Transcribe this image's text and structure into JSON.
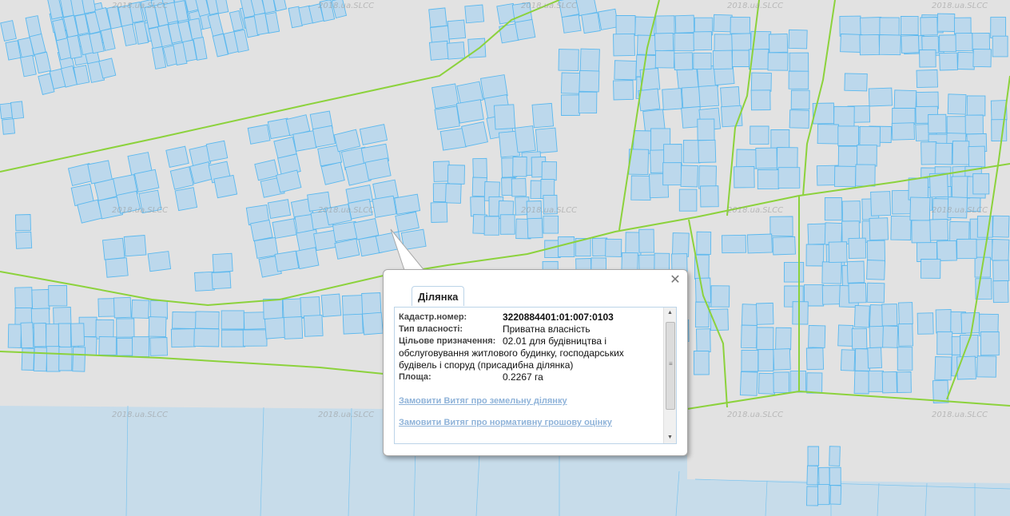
{
  "colors": {
    "map_background": "#e2e2e2",
    "parcel_fill": "#bcd8ec",
    "parcel_stroke": "#5bb8ee",
    "road_line": "#8cd23c",
    "water": "#c7dcea",
    "link": "#8fb3d9"
  },
  "watermark": "2018.ua.SLCC",
  "popup": {
    "tab_label": "Ділянка",
    "fields": [
      {
        "label": "Кадастр.номер:",
        "value": "3220884401:01:007:0103"
      },
      {
        "label": "Тип власності:",
        "value": "Приватна власність"
      },
      {
        "label": "Цільове призначення:",
        "value": "02.01 для будівництва і",
        "continuation": "обслуговування житлового будинку, господарських будівель і споруд (присадибна ділянка)"
      },
      {
        "label": "Площа:",
        "value": "0.2267 га"
      }
    ],
    "links": [
      "Замовити Витяг про земельну ділянку",
      "Замовити Витяг про нормативну грошову оцінку"
    ],
    "close_icon": "close-icon"
  }
}
